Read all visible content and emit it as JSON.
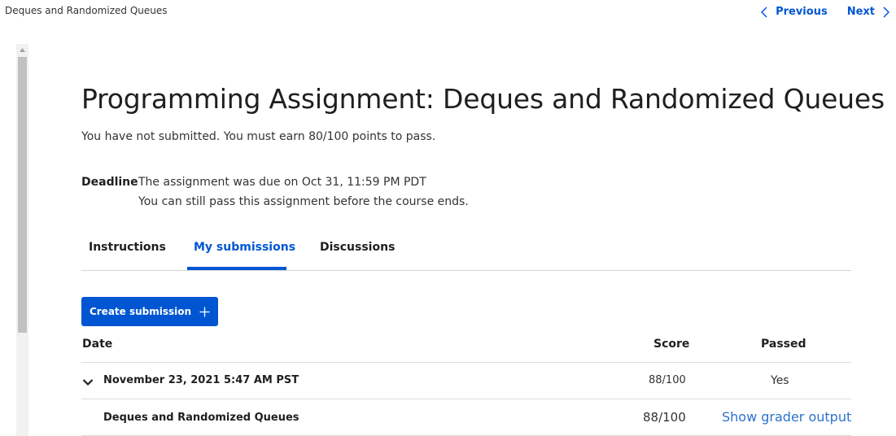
{
  "breadcrumb": "Deques and Randomized Queues",
  "nav": {
    "previous": "Previous",
    "next": "Next",
    "accent": "#0056d2"
  },
  "assignment": {
    "title": "Programming Assignment: Deques and Randomized Queues",
    "status": "You have not submitted. You must earn 80/100 points to pass.",
    "deadline_label": "Deadline",
    "deadline_line1": "The assignment was due on Oct 31, 11:59 PM PDT",
    "deadline_line2": "You can still pass this assignment before the course ends."
  },
  "tabs": [
    {
      "label": "Instructions",
      "active": false
    },
    {
      "label": "My submissions",
      "active": true
    },
    {
      "label": "Discussions",
      "active": false
    }
  ],
  "create_button": "Create submission",
  "table": {
    "headers": {
      "date": "Date",
      "score": "Score",
      "passed": "Passed"
    },
    "submission": {
      "date": "November 23, 2021 5:47 AM PST",
      "score": "88/100",
      "passed": "Yes",
      "part": {
        "name": "Deques and Randomized Queues",
        "score": "88/100",
        "link": "Show grader output"
      }
    }
  },
  "icons": {
    "previous": "chevron-left-icon",
    "next": "chevron-right-icon",
    "create": "plus-icon",
    "expand": "chevron-down-icon",
    "scroll_up": "arrow-up-icon"
  }
}
